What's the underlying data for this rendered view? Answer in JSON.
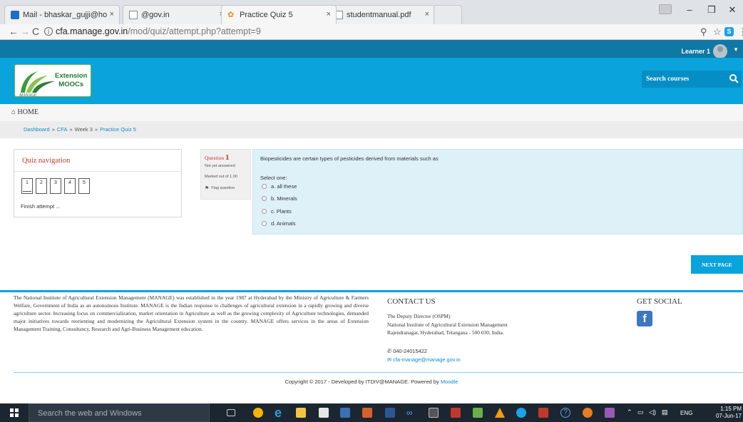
{
  "browser": {
    "tabs": [
      {
        "label": "Mail - bhaskar_gujji@ho"
      },
      {
        "label": "@gov.in"
      },
      {
        "label": "Practice Quiz 5"
      },
      {
        "label": "studentmanual.pdf"
      }
    ],
    "url_host": "cfa.manage.gov.in",
    "url_path": "/mod/quiz/attempt.php?attempt=9"
  },
  "header": {
    "user_name": "Learner 1",
    "logo_line1": "Extension",
    "logo_line2": "MOOCs",
    "logo_mark": "MANAGE",
    "search_placeholder": "Search courses"
  },
  "home_label": "HOME",
  "breadcrumb": [
    {
      "label": "Dashboard"
    },
    {
      "label": "CFA"
    },
    {
      "label": "Week 3"
    },
    {
      "label": "Practice Quiz 5"
    }
  ],
  "quiz_nav": {
    "title": "Quiz navigation",
    "buttons": [
      "1",
      "2",
      "3",
      "4",
      "5"
    ],
    "finish": "Finish attempt ..."
  },
  "question": {
    "label": "Question",
    "number": "1",
    "status": "Not yet answered",
    "marks": "Marked out of 1.00",
    "flag": "Flag question",
    "text": "Biopesticides are certain types of pesticides derived from materials such as",
    "prompt": "Select one:",
    "answers": [
      "a. all these",
      "b. Minerals",
      "c. Plants",
      "d. Animals"
    ]
  },
  "next_label": "NEXT PAGE",
  "footer": {
    "about": "The National Institute of Agricultural Extension Management (MANAGE) was established in the year 1987 at Hyderabad by the Ministry of Agriculture & Farmers Welfare, Government of India as an autonomous Institute. MANAGE is the Indian response to challenges of agricultural extension in a rapidly growing and diverse agriculture sector. Increasing focus on commercialization, market orientation in Agriculture as well as the growing complexity of Agriculture technologies, demanded major initiatives towards reorienting and modernizing the Agricultural Extension system in the country. MANAGE offers services in the areas of Extension Management Training, Consultancy, Research and Agri-Business Management education.",
    "contact_title": "CONTACT US",
    "contact_line1": "The Deputy Director (OSPM)",
    "contact_line2": "National Institute of Agricultural Extension Management",
    "contact_line3": "Rajendranagar, Hyderabad, Telangana - 500 030, India.",
    "phone": "040-24015422",
    "email": "cfa-manage@manage.gov.in",
    "social_title": "GET SOCIAL",
    "copyright": "Copyright © 2017 - Developed by ITDIV@MANAGE. Powered by ",
    "moodle": "Moodle"
  },
  "taskbar": {
    "search_placeholder": "Search the web and Windows",
    "lang": "ENG",
    "time": "1:15 PM",
    "date": "07-Jun-17"
  },
  "colors": {
    "brand_blue": "#0aa3dc",
    "dark_blue": "#0f78a4",
    "question_bg": "#def0f8",
    "accent_red": "#c0392b"
  }
}
